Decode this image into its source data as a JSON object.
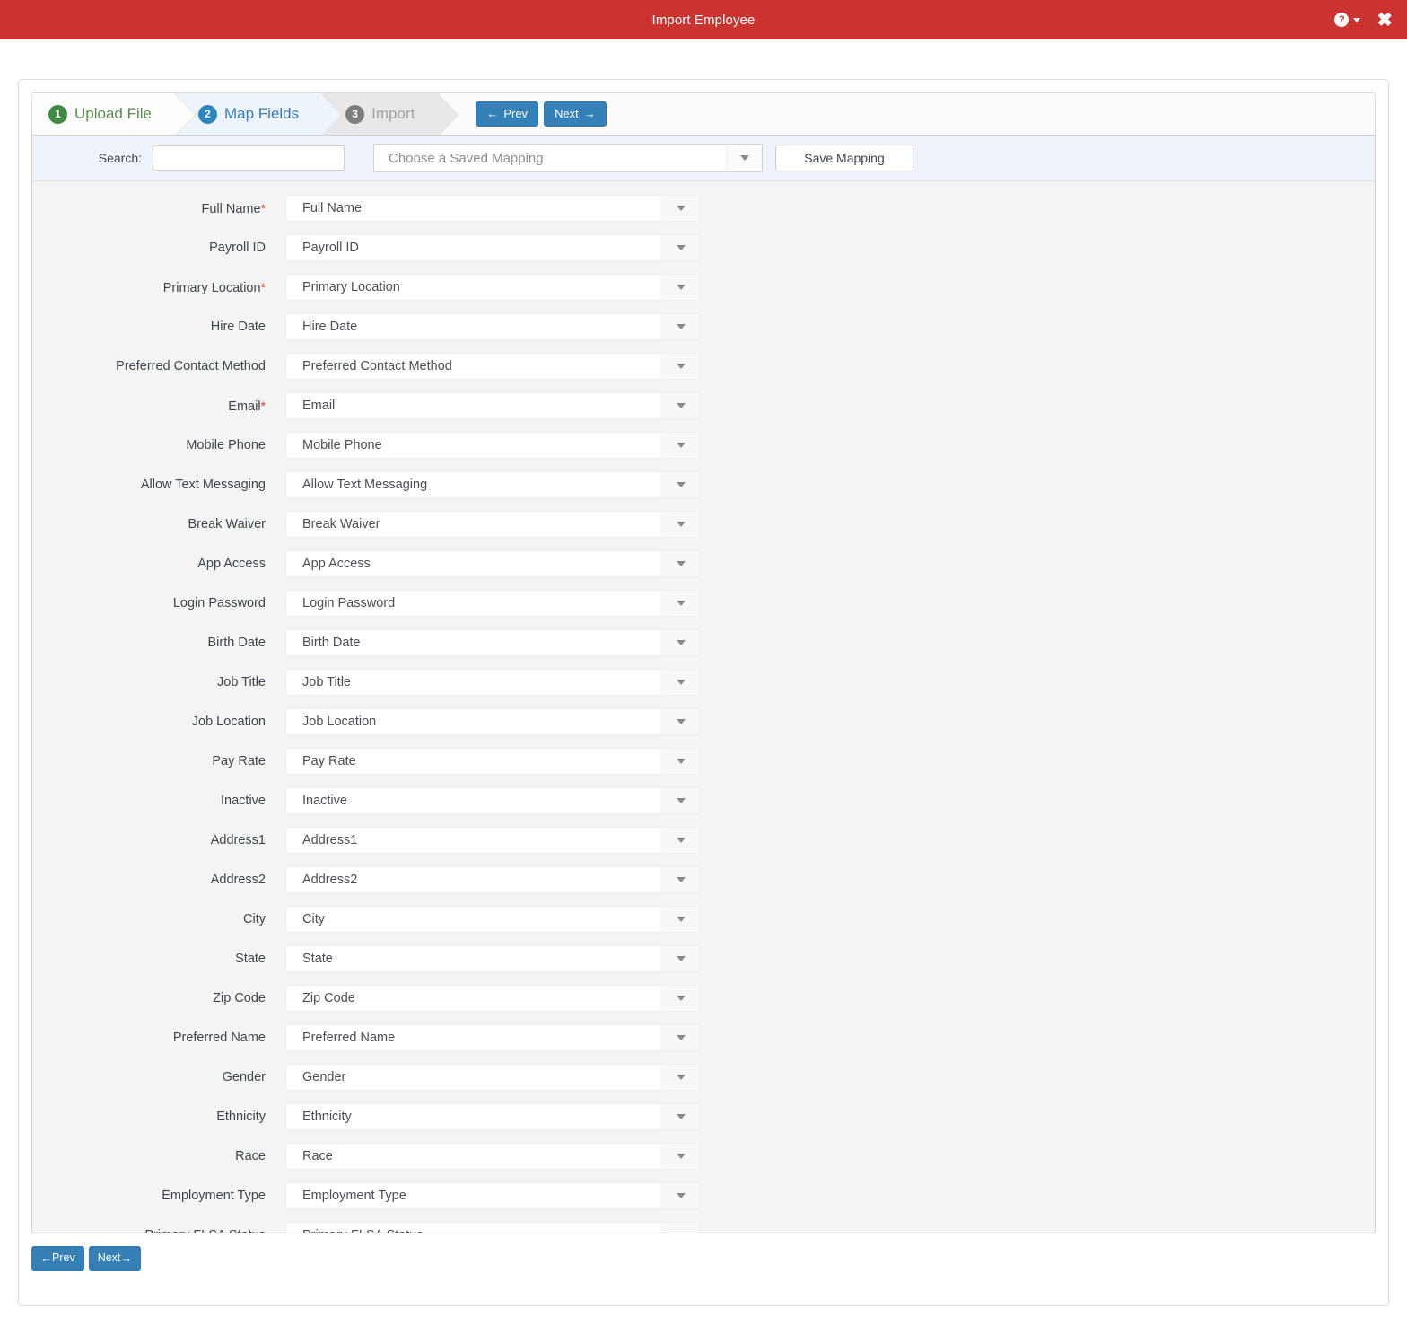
{
  "titlebar": {
    "title": "Import Employee",
    "help_icon": "question-mark-circle-icon",
    "help_caret": "chevron-down-icon",
    "close_label": "✖"
  },
  "wizard": {
    "steps": [
      {
        "num": "1",
        "label": "Upload File",
        "state": "complete",
        "color": "#3f8a41"
      },
      {
        "num": "2",
        "label": "Map Fields",
        "state": "active",
        "color": "#2e86c1"
      },
      {
        "num": "3",
        "label": "Import",
        "state": "pending",
        "color": "#7d7d7d"
      }
    ],
    "prev_label": "Prev",
    "next_label": "Next",
    "prev_arrow": "←",
    "next_arrow": "→"
  },
  "toolbar": {
    "search_label": "Search:",
    "search_value": "",
    "search_placeholder": "",
    "saved_mapping_value": "Choose a Saved Mapping",
    "save_mapping_label": "Save Mapping"
  },
  "fields": [
    {
      "label": "Full Name",
      "required": true,
      "value": "Full Name"
    },
    {
      "label": "Payroll ID",
      "required": false,
      "value": "Payroll ID"
    },
    {
      "label": "Primary Location",
      "required": true,
      "value": "Primary Location"
    },
    {
      "label": "Hire Date",
      "required": false,
      "value": "Hire Date"
    },
    {
      "label": "Preferred Contact Method",
      "required": false,
      "value": "Preferred Contact Method"
    },
    {
      "label": "Email",
      "required": true,
      "value": "Email"
    },
    {
      "label": "Mobile Phone",
      "required": false,
      "value": "Mobile Phone"
    },
    {
      "label": "Allow Text Messaging",
      "required": false,
      "value": "Allow Text Messaging"
    },
    {
      "label": "Break Waiver",
      "required": false,
      "value": "Break Waiver"
    },
    {
      "label": "App Access",
      "required": false,
      "value": "App Access"
    },
    {
      "label": "Login Password",
      "required": false,
      "value": "Login Password"
    },
    {
      "label": "Birth Date",
      "required": false,
      "value": "Birth Date"
    },
    {
      "label": "Job Title",
      "required": false,
      "value": "Job Title"
    },
    {
      "label": "Job Location",
      "required": false,
      "value": "Job Location"
    },
    {
      "label": "Pay Rate",
      "required": false,
      "value": "Pay Rate"
    },
    {
      "label": "Inactive",
      "required": false,
      "value": "Inactive"
    },
    {
      "label": "Address1",
      "required": false,
      "value": "Address1"
    },
    {
      "label": "Address2",
      "required": false,
      "value": "Address2"
    },
    {
      "label": "City",
      "required": false,
      "value": "City"
    },
    {
      "label": "State",
      "required": false,
      "value": "State"
    },
    {
      "label": "Zip Code",
      "required": false,
      "value": "Zip Code"
    },
    {
      "label": "Preferred Name",
      "required": false,
      "value": "Preferred Name"
    },
    {
      "label": "Gender",
      "required": false,
      "value": "Gender"
    },
    {
      "label": "Ethnicity",
      "required": false,
      "value": "Ethnicity"
    },
    {
      "label": "Race",
      "required": false,
      "value": "Race"
    },
    {
      "label": "Employment Type",
      "required": false,
      "value": "Employment Type"
    },
    {
      "label": "Primary FLSA Status",
      "required": false,
      "value": "Primary FLSA Status"
    }
  ],
  "bottom_nav": {
    "prev_label": "Prev",
    "next_label": "Next",
    "prev_arrow": "←",
    "next_arrow": "→"
  },
  "colors": {
    "header_red": "#cb3331",
    "primary_blue": "#3680b8",
    "step_green": "#3f8a41",
    "required_red": "#e23b34",
    "panel_gray": "#f4f4f4"
  }
}
